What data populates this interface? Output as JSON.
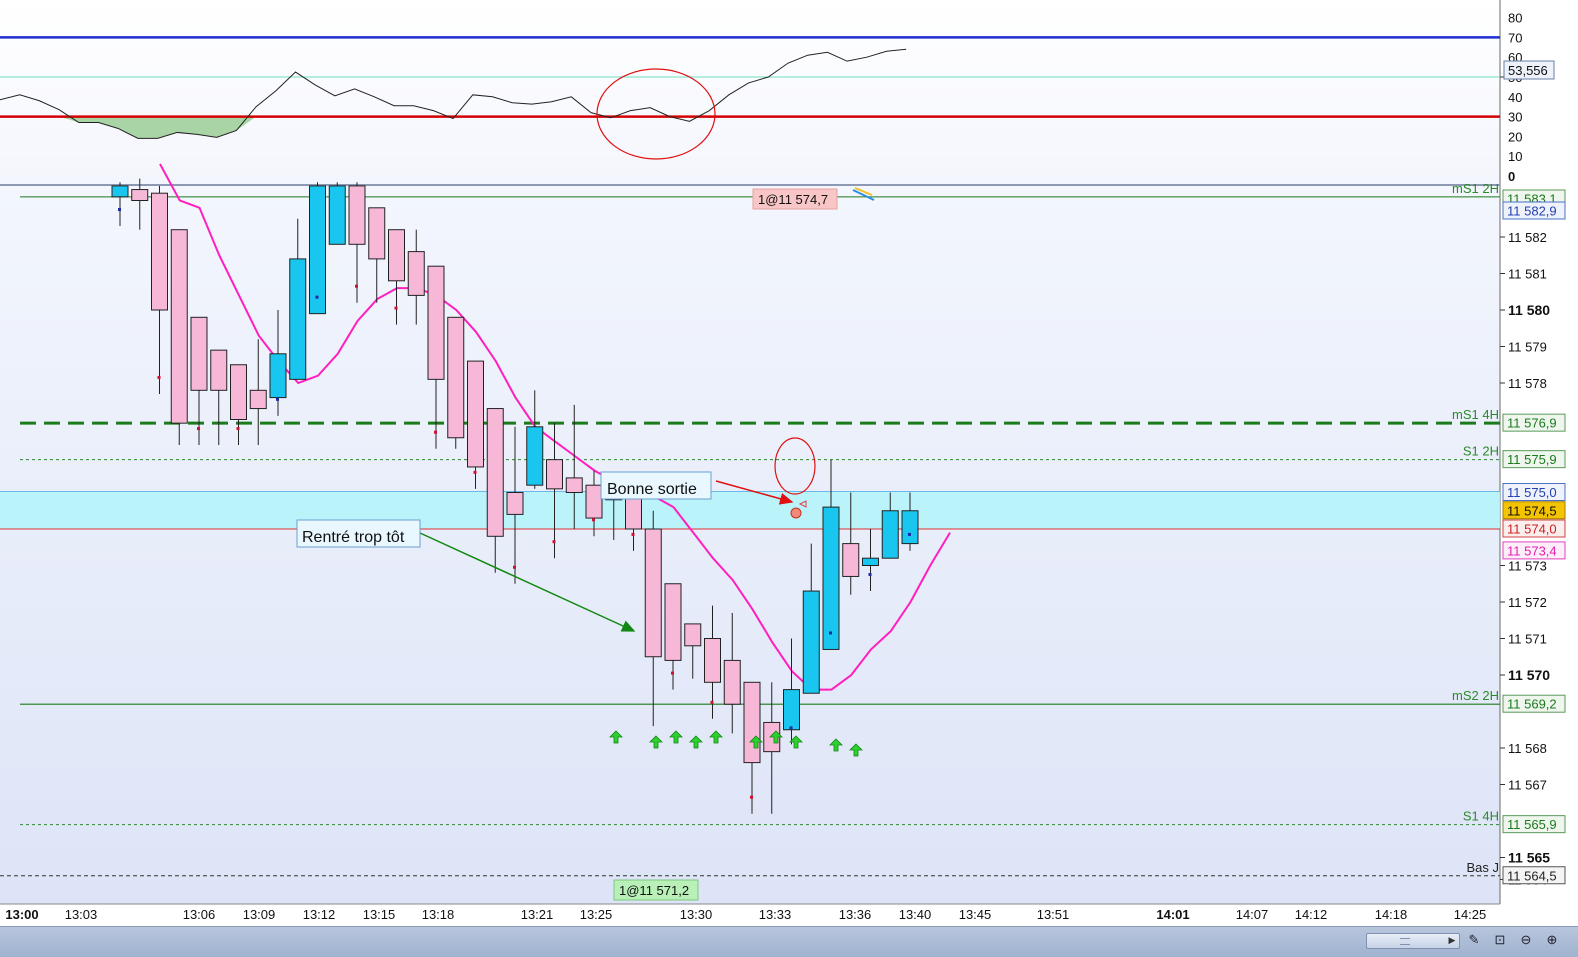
{
  "colors": {
    "bull": "#19c6f0",
    "bear": "#f7b8d8",
    "ma": "#ff1fbf",
    "green_line": "#1b7a1b",
    "band": "#b6f3fb",
    "rsi_upper": "#1f2fd0",
    "rsi_lower": "#d40000",
    "rsi_mid": "#6ee0c0"
  },
  "rsi_panel": {
    "axis_ticks": [
      "50",
      "80",
      "70",
      "60",
      "50",
      "40",
      "30",
      "20",
      "10",
      "0"
    ],
    "value_label": "53,556",
    "levels": [
      70,
      30,
      50
    ]
  },
  "price_axis": {
    "ticks": [
      "11 582",
      "11 581",
      "11 580",
      "11 579",
      "11 578",
      "11 573",
      "11 572",
      "11 571",
      "11 570",
      "11 568",
      "11 567",
      "11 565",
      "11 564"
    ],
    "bold_ticks": [
      "11 580",
      "11 570",
      "11 565"
    ],
    "tags": [
      {
        "text": "11 583,1",
        "kind": "green"
      },
      {
        "text": "11 582,9",
        "kind": "blue"
      },
      {
        "text": "11 576,9",
        "kind": "green"
      },
      {
        "text": "11 575,9",
        "kind": "green"
      },
      {
        "text": "11 575,0",
        "kind": "blue"
      },
      {
        "text": "11 574,5",
        "kind": "gold"
      },
      {
        "text": "11 574,0",
        "kind": "red"
      },
      {
        "text": "11 573,4",
        "kind": "pink"
      },
      {
        "text": "11 569,2",
        "kind": "green"
      },
      {
        "text": "11 565,9",
        "kind": "green"
      },
      {
        "text": "11 564,5",
        "kind": "gray"
      }
    ]
  },
  "level_labels": [
    "mS1 2H",
    "mS1 4H",
    "S1 2H",
    "mS2 2H",
    "S1 4H",
    "Bas J"
  ],
  "annotations": {
    "entry_note": "Rentré trop tôt",
    "exit_note": "Bonne sortie",
    "fill_top": "1@11 574,7",
    "fill_bottom": "1@11 571,2"
  },
  "time_axis": [
    "13:00",
    "13:03",
    "13:06",
    "13:09",
    "13:12",
    "13:15",
    "13:18",
    "13:21",
    "13:25",
    "13:30",
    "13:33",
    "13:36",
    "13:40",
    "13:45",
    "13:51",
    "14:01",
    "14:07",
    "14:12",
    "14:18",
    "14:25"
  ],
  "chart_data": {
    "type": "candlestick",
    "timeframe_labels": "x axis shows session times",
    "candles": [
      {
        "o": 11583.1,
        "h": 11583.5,
        "l": 11582.3,
        "c": 11583.4
      },
      {
        "o": 11583.3,
        "h": 11583.6,
        "l": 11582.2,
        "c": 11583.0
      },
      {
        "o": 11583.2,
        "h": 11583.4,
        "l": 11577.7,
        "c": 11580.0
      },
      {
        "o": 11582.2,
        "h": 11582.2,
        "l": 11576.3,
        "c": 11576.9
      },
      {
        "o": 11579.8,
        "h": 11579.8,
        "l": 11576.3,
        "c": 11577.8
      },
      {
        "o": 11578.9,
        "h": 11578.9,
        "l": 11576.3,
        "c": 11577.8
      },
      {
        "o": 11578.5,
        "h": 11578.5,
        "l": 11576.3,
        "c": 11577.0
      },
      {
        "o": 11577.8,
        "h": 11579.2,
        "l": 11576.3,
        "c": 11577.3
      },
      {
        "o": 11577.6,
        "h": 11580.0,
        "l": 11577.1,
        "c": 11578.8
      },
      {
        "o": 11578.1,
        "h": 11582.5,
        "l": 11578.1,
        "c": 11581.4
      },
      {
        "o": 11579.9,
        "h": 11583.5,
        "l": 11579.9,
        "c": 11583.4
      },
      {
        "o": 11581.8,
        "h": 11583.5,
        "l": 11581.8,
        "c": 11583.4
      },
      {
        "o": 11583.4,
        "h": 11583.5,
        "l": 11580.2,
        "c": 11581.8
      },
      {
        "o": 11582.8,
        "h": 11582.8,
        "l": 11580.2,
        "c": 11581.4
      },
      {
        "o": 11582.2,
        "h": 11582.2,
        "l": 11579.6,
        "c": 11580.8
      },
      {
        "o": 11581.6,
        "h": 11582.2,
        "l": 11579.6,
        "c": 11580.4
      },
      {
        "o": 11581.2,
        "h": 11581.2,
        "l": 11576.2,
        "c": 11578.1
      },
      {
        "o": 11579.8,
        "h": 11579.8,
        "l": 11576.2,
        "c": 11576.5
      },
      {
        "o": 11578.6,
        "h": 11578.6,
        "l": 11575.1,
        "c": 11575.7
      },
      {
        "o": 11577.3,
        "h": 11577.3,
        "l": 11572.8,
        "c": 11573.8
      },
      {
        "o": 11575.0,
        "h": 11576.8,
        "l": 11572.5,
        "c": 11574.4
      },
      {
        "o": 11575.2,
        "h": 11577.8,
        "l": 11575.1,
        "c": 11576.8
      },
      {
        "o": 11575.9,
        "h": 11576.9,
        "l": 11573.2,
        "c": 11575.1
      },
      {
        "o": 11575.4,
        "h": 11577.4,
        "l": 11574.0,
        "c": 11575.0
      },
      {
        "o": 11575.2,
        "h": 11575.6,
        "l": 11573.8,
        "c": 11574.3
      },
      {
        "o": 11574.8,
        "h": 11575.4,
        "l": 11573.7,
        "c": 11574.9
      },
      {
        "o": 11575.2,
        "h": 11575.4,
        "l": 11573.4,
        "c": 11574.0
      },
      {
        "o": 11574.0,
        "h": 11574.5,
        "l": 11568.6,
        "c": 11570.5
      },
      {
        "o": 11572.5,
        "h": 11572.5,
        "l": 11569.6,
        "c": 11570.4
      },
      {
        "o": 11571.4,
        "h": 11571.4,
        "l": 11569.9,
        "c": 11570.8
      },
      {
        "o": 11571.0,
        "h": 11571.9,
        "l": 11568.8,
        "c": 11569.8
      },
      {
        "o": 11570.4,
        "h": 11571.7,
        "l": 11568.4,
        "c": 11569.2
      },
      {
        "o": 11569.8,
        "h": 11569.8,
        "l": 11566.2,
        "c": 11567.6
      },
      {
        "o": 11568.7,
        "h": 11569.8,
        "l": 11566.2,
        "c": 11567.9
      },
      {
        "o": 11568.5,
        "h": 11571.0,
        "l": 11568.1,
        "c": 11569.6
      },
      {
        "o": 11569.5,
        "h": 11573.6,
        "l": 11569.5,
        "c": 11572.3
      },
      {
        "o": 11570.7,
        "h": 11575.9,
        "l": 11570.7,
        "c": 11574.6
      },
      {
        "o": 11573.6,
        "h": 11575.0,
        "l": 11572.2,
        "c": 11572.7
      },
      {
        "o": 11573.0,
        "h": 11574.0,
        "l": 11572.3,
        "c": 11573.2
      },
      {
        "o": 11573.2,
        "h": 11575.0,
        "l": 11573.2,
        "c": 11574.5
      },
      {
        "o": 11573.6,
        "h": 11575.0,
        "l": 11573.4,
        "c": 11574.5
      }
    ],
    "moving_average": [
      11584,
      11583,
      11582.8,
      11581.5,
      11580.4,
      11579.3,
      11578.6,
      11578.0,
      11578.2,
      11578.8,
      11579.7,
      11580.3,
      11580.6,
      11580.6,
      11580.4,
      11580.0,
      11579.4,
      11578.6,
      11577.6,
      11576.8,
      11576.4,
      11576.0,
      11575.6,
      11575.3,
      11575.1,
      11574.9,
      11574.6,
      11573.9,
      11573.2,
      11572.6,
      11571.8,
      11570.9,
      11570.1,
      11569.6,
      11569.6,
      11570.0,
      11570.7,
      11571.2,
      11572.0,
      11573.0,
      11573.9
    ],
    "rsi": [
      38.5,
      41,
      38,
      33.5,
      27,
      27,
      24,
      19,
      19,
      22,
      21,
      19.5,
      23,
      35,
      43,
      52.5,
      46,
      40.5,
      44,
      40,
      35.5,
      35.5,
      33,
      29,
      41,
      40,
      37,
      36.3,
      37.5,
      40,
      32,
      29.4,
      33,
      34.5,
      30,
      27.6,
      33,
      41,
      47,
      50,
      57,
      61,
      62.5,
      58,
      60,
      63,
      64
    ],
    "levels": [
      {
        "name": "mS1 2H",
        "price": 11583.1
      },
      {
        "name": "mS1 4H",
        "price": 11576.9
      },
      {
        "name": "S1 2H",
        "price": 11575.9
      },
      {
        "name": "mS2 2H",
        "price": 11569.2
      },
      {
        "name": "S1 4H",
        "price": 11565.9
      },
      {
        "name": "Bas J",
        "price": 11564.5
      }
    ],
    "zone": [
      11574.0,
      11575.0
    ],
    "last_price": 11574.5,
    "y_range": [
      11563.5,
      11583.5
    ]
  }
}
